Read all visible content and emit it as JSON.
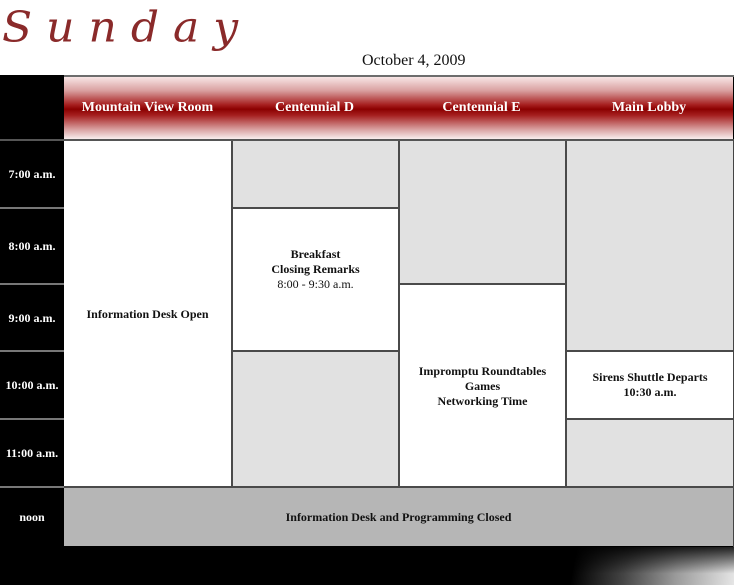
{
  "header": {
    "day": "Sunday",
    "date": "October 4, 2009"
  },
  "rooms": [
    "Mountain View Room",
    "Centennial D",
    "Centennial E",
    "Main Lobby"
  ],
  "times": [
    "7:00 a.m.",
    "8:00 a.m.",
    "9:00 a.m.",
    "10:00 a.m.",
    "11:00 a.m.",
    "noon"
  ],
  "events": {
    "info_desk": {
      "title": "Information Desk Open"
    },
    "breakfast": {
      "line1": "Breakfast",
      "line2": "Closing Remarks",
      "time": "8:00 - 9:30 a.m."
    },
    "roundtables": {
      "line1": "Impromptu Roundtables",
      "line2": "Games",
      "line3": "Networking Time"
    },
    "shuttle": {
      "title": "Sirens Shuttle Departs",
      "time": "10:30 a.m."
    },
    "closed": {
      "title": "Information Desk and Programming Closed"
    }
  },
  "colors": {
    "header_red": "#8b0000",
    "title_script": "#8a2a2a",
    "empty_slot": "#e1e1e1",
    "closed_band": "#b6b6b6",
    "time_column": "#000000"
  }
}
